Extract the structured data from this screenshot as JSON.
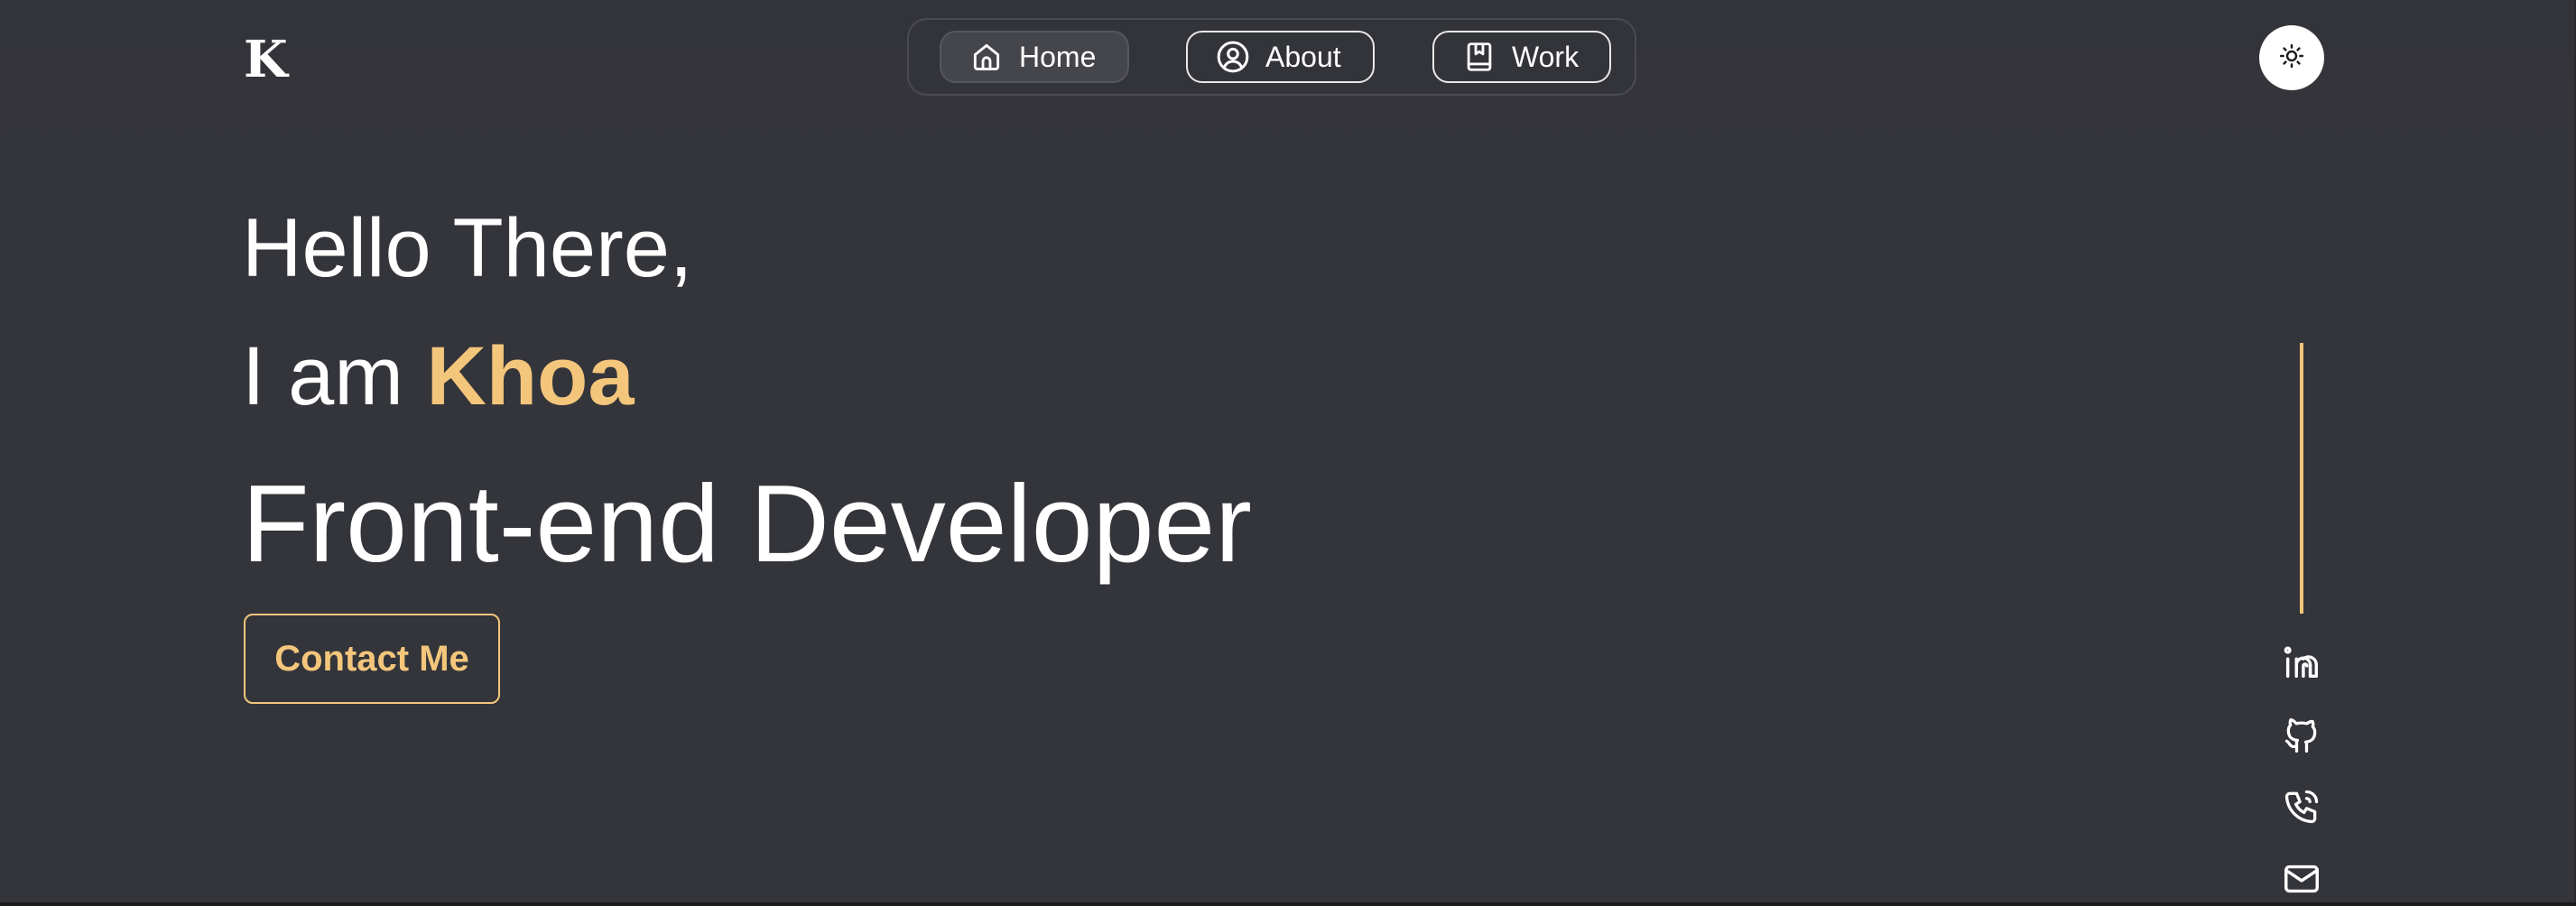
{
  "brand": {
    "logo_text": "K"
  },
  "nav": {
    "items": [
      {
        "label": "Home",
        "icon": "home-icon",
        "active": true
      },
      {
        "label": "About",
        "icon": "user-circle-icon",
        "active": false
      },
      {
        "label": "Work",
        "icon": "book-bookmark-icon",
        "active": false
      }
    ]
  },
  "theme_toggle": {
    "icon": "sun-icon"
  },
  "hero": {
    "greeting": "Hello There,",
    "intro_prefix": "I am ",
    "name": "Khoa",
    "role": "Front-end Developer",
    "cta_label": "Contact Me"
  },
  "social": {
    "items": [
      {
        "icon": "linkedin-icon"
      },
      {
        "icon": "github-icon"
      },
      {
        "icon": "phone-icon"
      },
      {
        "icon": "mail-icon"
      }
    ]
  },
  "colors": {
    "background": "#34353a",
    "accent": "#f4c67c",
    "text": "#ffffff"
  }
}
